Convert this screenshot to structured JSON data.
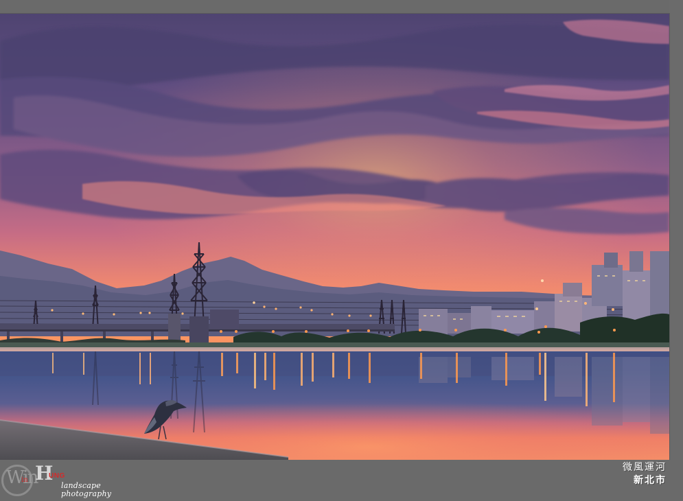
{
  "photo": {
    "scene": "sunset over river with city skyline, transmission towers, mountains and a heron on the bank"
  },
  "logo": {
    "main_letters": "Win",
    "secondary": "in",
    "badge_letter": "H",
    "badge_suffix": "UNG",
    "tagline": "landscape photography"
  },
  "caption": {
    "line1": "微風運河",
    "line2": "新北市"
  },
  "colors": {
    "frame": "#6a6a6a",
    "logo_red": "#d52a2a",
    "text_light": "#ffffff"
  }
}
